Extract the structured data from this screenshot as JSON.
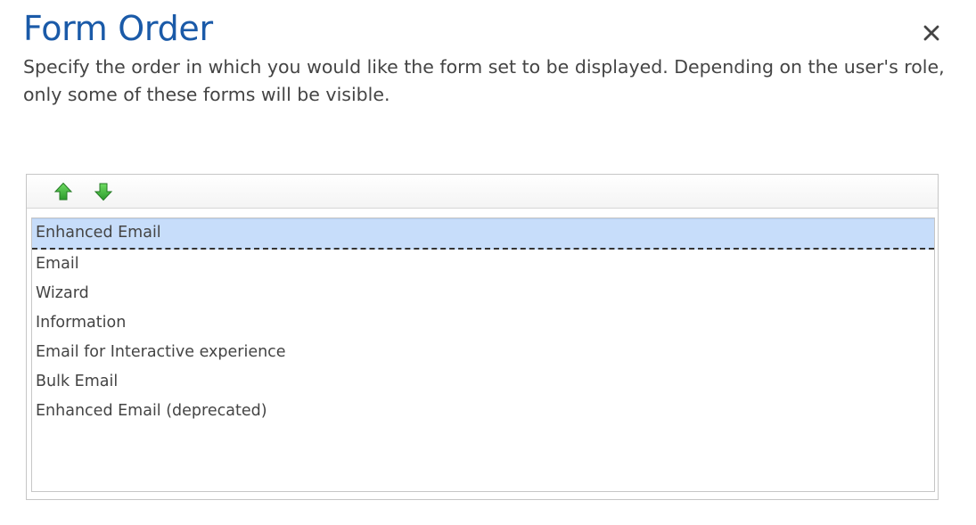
{
  "dialog": {
    "title": "Form Order",
    "description": "Specify the order in which you would like the form set to be displayed. Depending on the user's role, only some of these forms will be visible.",
    "close_icon": "close-icon"
  },
  "toolbar": {
    "move_up_icon": "arrow-up-icon",
    "move_down_icon": "arrow-down-icon",
    "icon_color": "#3cb043"
  },
  "forms": {
    "selected_index": 0,
    "selected_color": "#c7ddfa",
    "items": [
      {
        "label": "Enhanced Email"
      },
      {
        "label": "Email"
      },
      {
        "label": "Wizard"
      },
      {
        "label": "Information"
      },
      {
        "label": "Email for Interactive experience"
      },
      {
        "label": "Bulk Email"
      },
      {
        "label": "Enhanced Email (deprecated)"
      }
    ]
  }
}
